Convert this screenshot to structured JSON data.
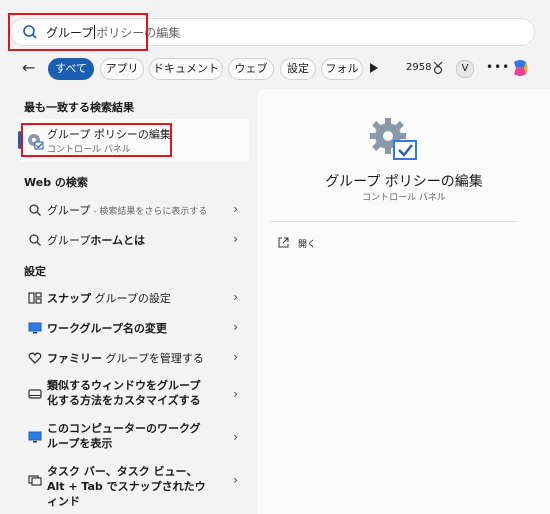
{
  "search": {
    "typed": "グループ",
    "suggestion": "ポリシーの編集"
  },
  "filters": [
    "すべて",
    "アプリ",
    "ドキュメント",
    "ウェブ",
    "設定",
    "フォル"
  ],
  "toolbar": {
    "points": "2958",
    "avatar": "V",
    "more": "•••"
  },
  "best_match": {
    "heading": "最も一致する検索結果",
    "title": "グループ ポリシーの編集",
    "subtitle": "コントロール パネル"
  },
  "web": {
    "heading": "Web の検索",
    "items": [
      {
        "label": "グループ",
        "hint": " - 検索結果をさらに表示する"
      },
      {
        "label_plain": "グループ",
        "label_bold": "ホームとは"
      }
    ]
  },
  "settings": {
    "heading": "設定",
    "items": [
      {
        "bold": "スナップ",
        "plain": " グループの設定"
      },
      {
        "bold": "ワークグループ名の変更",
        "plain": ""
      },
      {
        "bold": "ファミリー",
        "plain": " グループを管理する"
      },
      {
        "bold": "類似するウィンドウをグループ化する方法をカスタマイズする",
        "plain": ""
      },
      {
        "bold": "このコンピューターのワークグループを表示",
        "plain": ""
      },
      {
        "bold": "タスク バー、タスク ビュー、Alt + Tab でスナップされたウィンド",
        "plain": ""
      }
    ]
  },
  "detail": {
    "title": "グループ ポリシーの編集",
    "subtitle": "コントロール パネル",
    "open_label": "開く"
  },
  "colors": {
    "accent": "#1a5fb4",
    "highlight": "#e0141e"
  }
}
